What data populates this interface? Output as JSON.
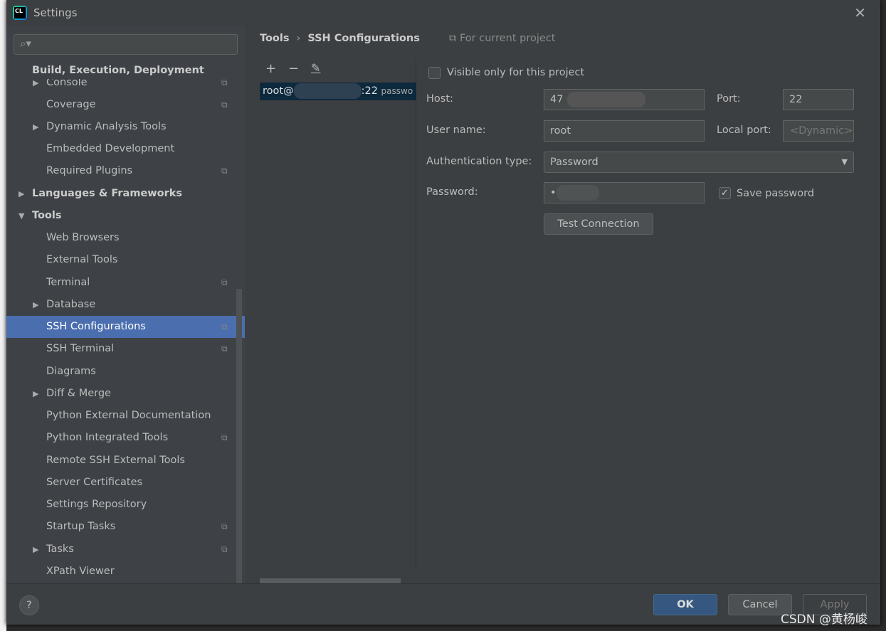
{
  "window": {
    "title": "Settings"
  },
  "sidebar": {
    "search_placeholder": "",
    "items": [
      {
        "label": "Build, Execution, Deployment",
        "level": 0,
        "bold": true
      },
      {
        "label": "Console",
        "level": 1,
        "arrow": true,
        "copy": true
      },
      {
        "label": "Coverage",
        "level": 1,
        "copy": true
      },
      {
        "label": "Dynamic Analysis Tools",
        "level": 1,
        "arrow": true
      },
      {
        "label": "Embedded Development",
        "level": 1
      },
      {
        "label": "Required Plugins",
        "level": 1,
        "copy": true
      },
      {
        "label": "Languages & Frameworks",
        "level": 0,
        "bold": true,
        "arrow": true
      },
      {
        "label": "Tools",
        "level": 0,
        "bold": true,
        "expanded": true
      },
      {
        "label": "Web Browsers",
        "level": 1
      },
      {
        "label": "External Tools",
        "level": 1
      },
      {
        "label": "Terminal",
        "level": 1,
        "copy": true
      },
      {
        "label": "Database",
        "level": 1,
        "arrow": true
      },
      {
        "label": "SSH Configurations",
        "level": 1,
        "copy": true,
        "selected": true
      },
      {
        "label": "SSH Terminal",
        "level": 1,
        "copy": true
      },
      {
        "label": "Diagrams",
        "level": 1
      },
      {
        "label": "Diff & Merge",
        "level": 1,
        "arrow": true
      },
      {
        "label": "Python External Documentation",
        "level": 1
      },
      {
        "label": "Python Integrated Tools",
        "level": 1,
        "copy": true
      },
      {
        "label": "Remote SSH External Tools",
        "level": 1
      },
      {
        "label": "Server Certificates",
        "level": 1
      },
      {
        "label": "Settings Repository",
        "level": 1
      },
      {
        "label": "Startup Tasks",
        "level": 1,
        "copy": true
      },
      {
        "label": "Tasks",
        "level": 1,
        "arrow": true,
        "copy": true
      },
      {
        "label": "XPath Viewer",
        "level": 1
      }
    ]
  },
  "breadcrumb": {
    "parent": "Tools",
    "current": "SSH Configurations",
    "scope": "For current project"
  },
  "list": {
    "entry_prefix": "root@",
    "entry_suffix": ":22",
    "entry_auth": "passwo"
  },
  "form": {
    "visible_only_label": "Visible only for this project",
    "visible_only": false,
    "host_label": "Host:",
    "host_value": "47",
    "port_label": "Port:",
    "port_value": "22",
    "user_label": "User name:",
    "user_value": "root",
    "local_port_label": "Local port:",
    "local_port_placeholder": "<Dynamic>",
    "auth_label": "Authentication type:",
    "auth_value": "Password",
    "password_label": "Password:",
    "password_value": "•",
    "save_password_label": "Save password",
    "save_password": true,
    "test_button": "Test Connection"
  },
  "footer": {
    "help": "?",
    "ok": "OK",
    "cancel": "Cancel",
    "apply": "Apply"
  },
  "watermark": "CSDN @黄杨峻"
}
